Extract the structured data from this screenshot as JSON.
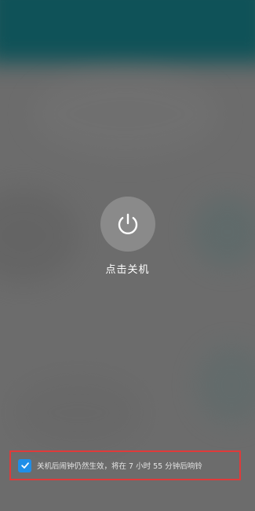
{
  "power": {
    "icon": "power-icon",
    "label": "点击关机"
  },
  "alarm_notice": {
    "checked": true,
    "icon": "check-icon",
    "text": "关机后闹钟仍然生效，将在 7 小时 55 分钟后响铃",
    "checkbox_color": "#1f8ee8",
    "highlight_color": "#e03a3a"
  }
}
